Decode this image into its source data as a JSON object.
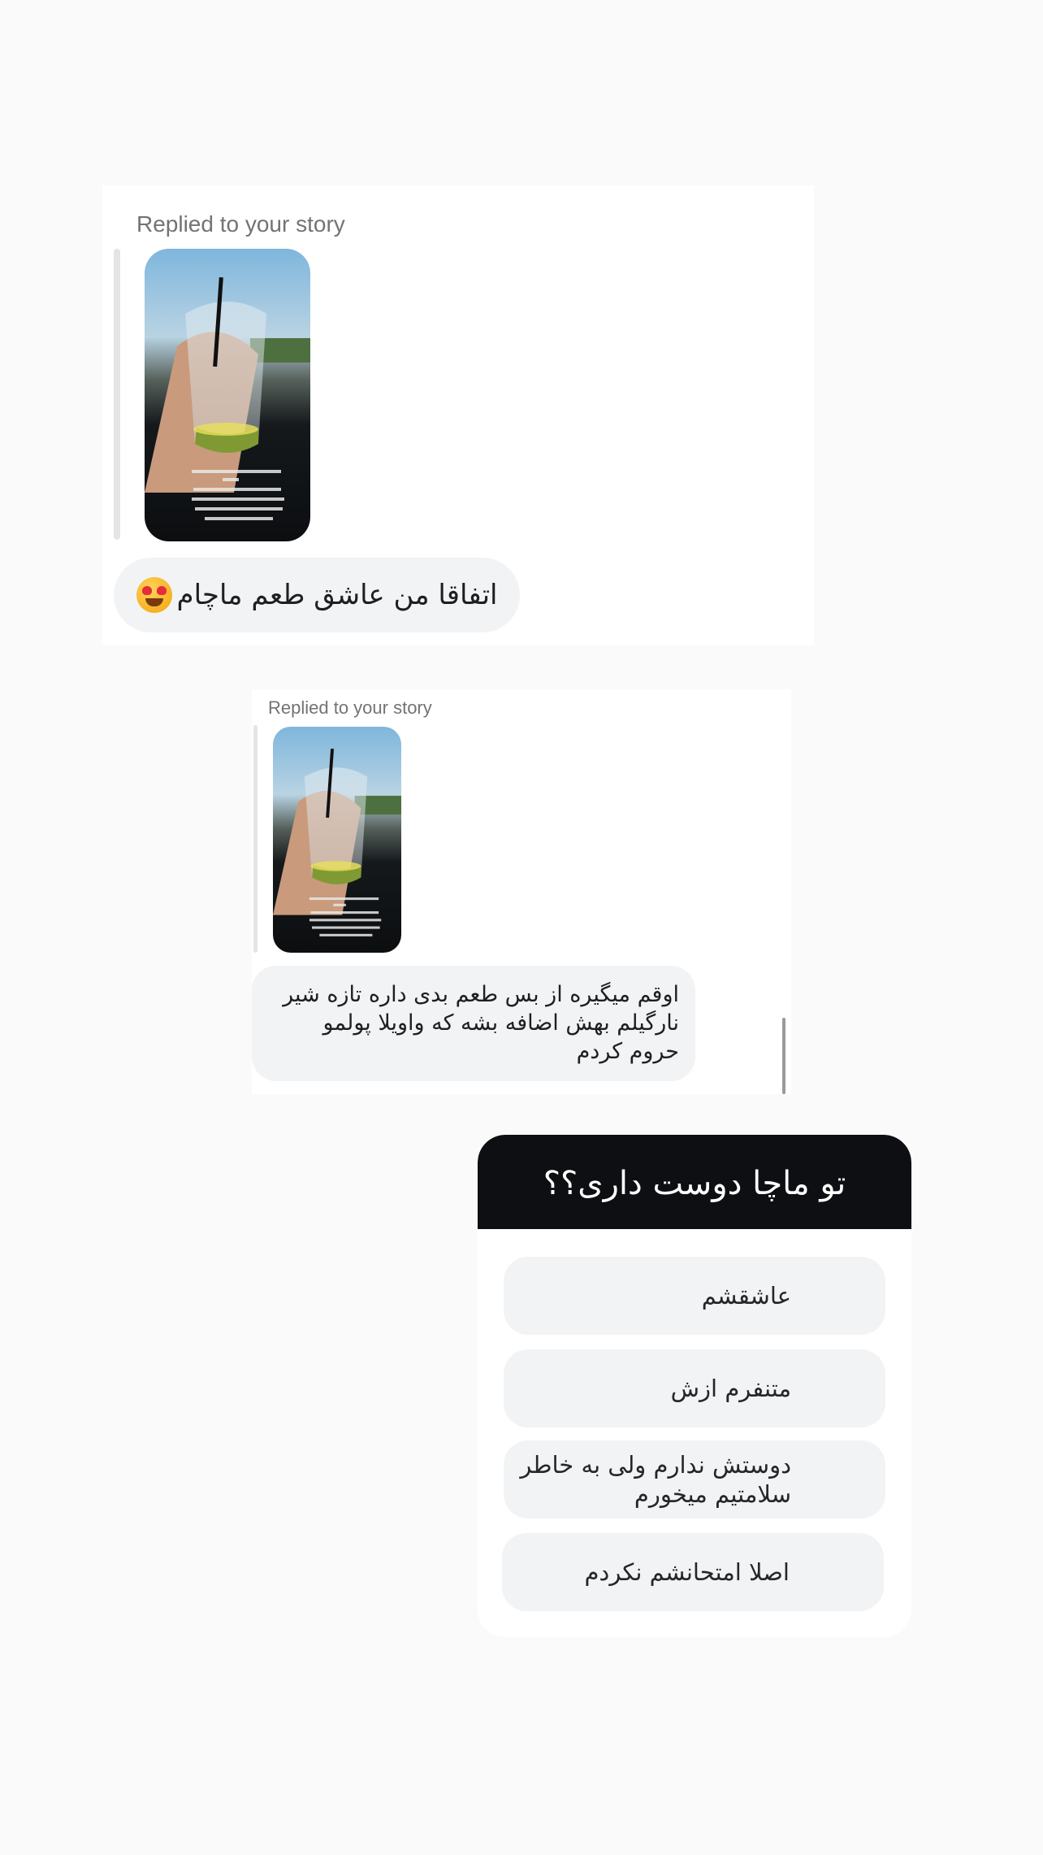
{
  "messages": [
    {
      "replied_label": "Replied to your story",
      "text": "اتفاقا من عاشق طعم ماچام"
    },
    {
      "replied_label": "Replied to your story",
      "text": "اوقم میگیره از بس طعم بدی داره تازه شیر نارگیلم بهش اضافه بشه که واویلا پولمو حروم کردم"
    }
  ],
  "poll": {
    "question": "تو ماچا دوست داری؟؟",
    "options": [
      "عاشقشم",
      "متنفرم ازش",
      "دوستش ندارم ولی به خاطر سلامتیم میخورم",
      "اصلا امتحانشم نکردم"
    ]
  },
  "icons": {
    "reaction_emoji": "heart-eyes-emoji-icon"
  }
}
